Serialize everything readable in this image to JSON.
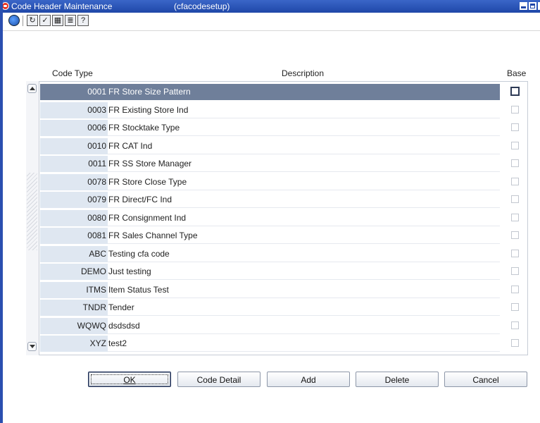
{
  "window": {
    "title": "Code Header Maintenance",
    "form_name": "(cfacodesetup)"
  },
  "toolbar": {
    "icons": [
      "globe-icon",
      "refresh-icon",
      "check-icon",
      "calendar-icon",
      "notes-icon",
      "help-icon"
    ],
    "glyphs": [
      "",
      "↻",
      "✓",
      "▦",
      "≣",
      "?"
    ]
  },
  "table": {
    "headers": {
      "code_type": "Code Type",
      "description": "Description",
      "base": "Base"
    },
    "rows": [
      {
        "code": "0001",
        "description": "FR Store Size Pattern",
        "base": false,
        "selected": true
      },
      {
        "code": "0003",
        "description": "FR Existing Store Ind",
        "base": false
      },
      {
        "code": "0006",
        "description": "FR Stocktake Type",
        "base": false
      },
      {
        "code": "0010",
        "description": "FR CAT Ind",
        "base": false
      },
      {
        "code": "0011",
        "description": "FR SS Store Manager",
        "base": false
      },
      {
        "code": "0078",
        "description": "FR Store Close Type",
        "base": false
      },
      {
        "code": "0079",
        "description": "FR Direct/FC Ind",
        "base": false
      },
      {
        "code": "0080",
        "description": "FR Consignment Ind",
        "base": false
      },
      {
        "code": "0081",
        "description": "FR Sales Channel Type",
        "base": false
      },
      {
        "code": "ABC",
        "description": "Testing cfa code",
        "base": false
      },
      {
        "code": "DEMO",
        "description": "Just testing",
        "base": false
      },
      {
        "code": "ITMS",
        "description": "Item Status Test",
        "base": false
      },
      {
        "code": "TNDR",
        "description": "Tender",
        "base": false
      },
      {
        "code": "WQWQ",
        "description": "dsdsdsd",
        "base": false
      },
      {
        "code": "XYZ",
        "description": "test2",
        "base": false
      }
    ]
  },
  "buttons": {
    "ok": "OK",
    "code_detail": "Code Detail",
    "add": "Add",
    "delete": "Delete",
    "cancel": "Cancel"
  },
  "colors": {
    "titlebar": "#1f47a8",
    "selected_row": "#6f7f9a",
    "code_cell": "#dfe7f1"
  }
}
